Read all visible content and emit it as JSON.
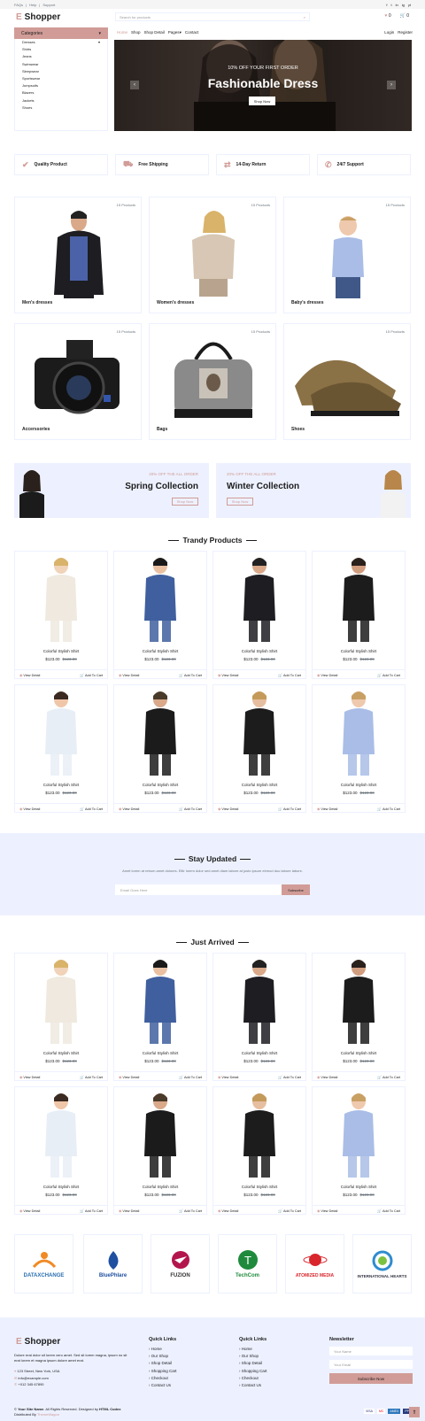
{
  "topbar": {
    "links": [
      "FAQs",
      "|",
      "Help",
      "|",
      "Support"
    ],
    "social": [
      "f",
      "t",
      "in",
      "ig",
      "yt"
    ]
  },
  "header": {
    "logo_e": "E",
    "logo_text": "Shopper",
    "search_placeholder": "Search for products",
    "heart_count": "0",
    "cart_count": "0"
  },
  "categories": {
    "label": "Categories",
    "items": [
      "Dresses",
      "Shirts",
      "Jeans",
      "Swimwear",
      "Sleepwear",
      "Sportswear",
      "Jumpsuits",
      "Blazers",
      "Jackets",
      "Shoes"
    ]
  },
  "nav": {
    "items": [
      "Home",
      "Shop",
      "Shop Detail",
      "Pages",
      "Contact"
    ],
    "right": [
      "Login",
      "Register"
    ]
  },
  "hero": {
    "subtitle": "10% OFF YOUR FIRST ORDER",
    "title": "Fashionable Dress",
    "button": "Shop Now"
  },
  "features": [
    "Quality Product",
    "Free Shipping",
    "14-Day Return",
    "24/7 Support"
  ],
  "cat_cards": [
    {
      "name": "Men's dresses",
      "count": "15 Products"
    },
    {
      "name": "Women's dresses",
      "count": "15 Products"
    },
    {
      "name": "Baby's dresses",
      "count": "15 Products"
    },
    {
      "name": "Accerssories",
      "count": "15 Products"
    },
    {
      "name": "Bags",
      "count": "15 Products"
    },
    {
      "name": "Shoes",
      "count": "15 Products"
    }
  ],
  "offers": [
    {
      "label": "20% OFF THE ALL ORDER",
      "title": "Spring Collection",
      "button": "Shop Now"
    },
    {
      "label": "20% OFF THE ALL ORDER",
      "title": "Winter Collection",
      "button": "Shop Now"
    }
  ],
  "trendy": {
    "title": "Trandy Products"
  },
  "product": {
    "name": "Colorful Stylish Shirt",
    "price": "$123.00",
    "old": "$123.00",
    "view": "View Detail",
    "cart": "Add To Cart"
  },
  "newsletter": {
    "title": "Stay Updated",
    "text": "Amet lorem at rebum amet dolores. Elitr lorem dolor sed amet diam labore at justo ipsum eirmod duo labore labore.",
    "placeholder": "Email Goes Here",
    "button": "Subscribe"
  },
  "arrived": {
    "title": "Just Arrived"
  },
  "vendors": [
    "DATAXCHANGE",
    "BluePhlare",
    "FUZION",
    "TechCom",
    "ATOMIZED MEDIA",
    "INTERNATIONAL HEARTS"
  ],
  "footer": {
    "logo_e": "E",
    "logo_text": "Shopper",
    "about": "Dolore erat dolor sit lorem vero amet. Sed sit lorem magna, ipsum no sit erat lorem et magna ipsum dolore amet erat.",
    "address": "123 Street, New York, USA",
    "email": "info@example.com",
    "phone": "+012 345 67890",
    "quick1": "Quick Links",
    "quick2": "Quick Links",
    "links": [
      "Home",
      "Our Shop",
      "Shop Detail",
      "Shopping Cart",
      "Checkout",
      "Contact Us"
    ],
    "newsletter": "Newsletter",
    "name_ph": "Your Name",
    "email_ph": "Your Email",
    "subscribe": "Subscribe Now",
    "copy_a": "© ",
    "copy_site": "Your Site Name",
    "copy_b": ". All Rights Reserved. Designed by ",
    "copy_html": "HTML Codex",
    "dist_a": "Distributed By ",
    "dist_b": "ThemeWagon",
    "pay": [
      "VISA",
      "MC",
      "AMEX",
      "PP"
    ]
  },
  "colors": {
    "accent": "#d19c97",
    "light": "#edf1ff",
    "dark": "#1c1c1c"
  }
}
